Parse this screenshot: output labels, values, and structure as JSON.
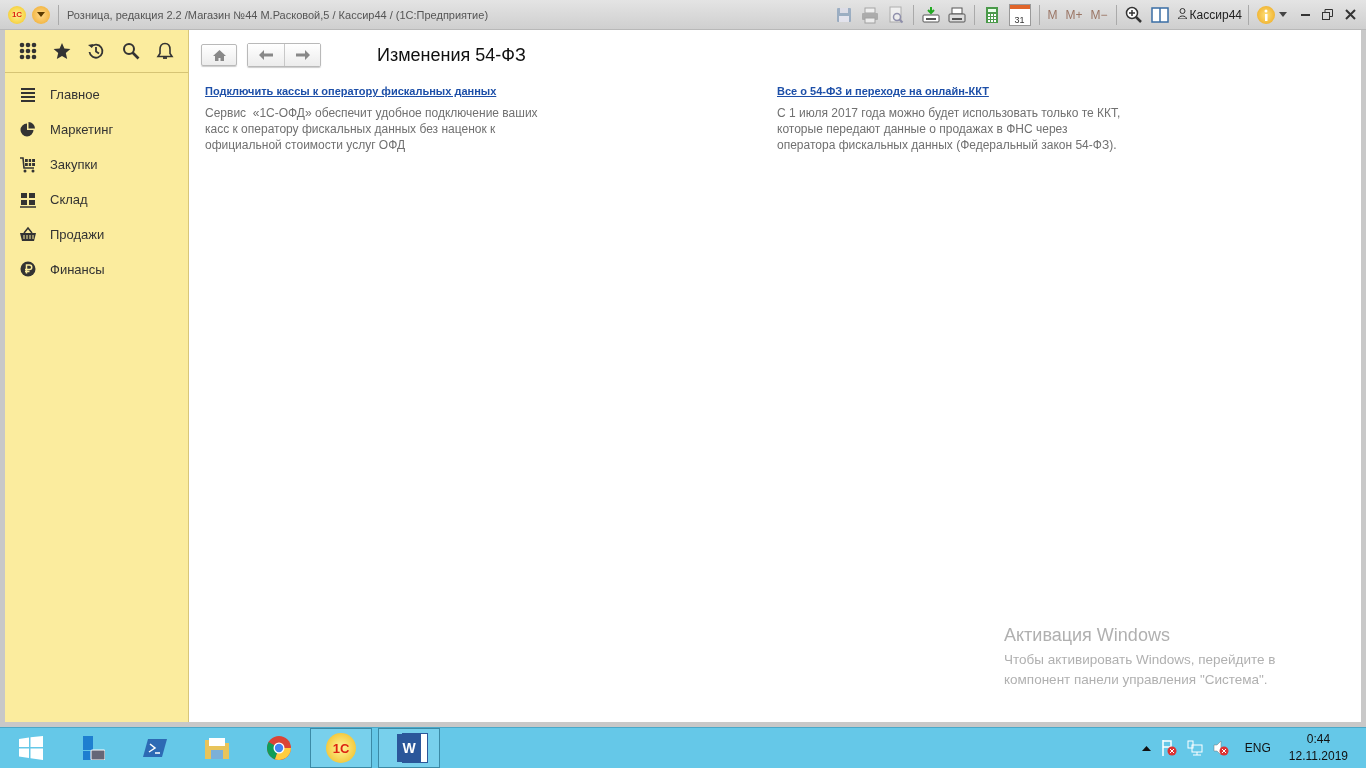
{
  "titlebar": {
    "logo": "1С",
    "title": "Розница, редакция 2.2 /Магазин №44 М.Расковой,5 / Кассир44 /  (1С:Предприятие)",
    "toolbar": [
      {
        "kind": "icon",
        "disabled": true
      },
      {
        "kind": "icon",
        "disabled": true
      },
      {
        "kind": "icon",
        "disabled": true
      },
      {
        "kind": "icon",
        "disabled": false
      },
      {
        "kind": "icon",
        "disabled": false
      },
      {
        "kind": "icon",
        "disabled": false
      },
      {
        "kind": "calendar",
        "label": "31",
        "disabled": false
      },
      {
        "kind": "text",
        "label": "M",
        "disabled": true
      },
      {
        "kind": "text",
        "label": "M+",
        "disabled": true
      },
      {
        "kind": "text",
        "label": "M−",
        "disabled": true
      },
      {
        "kind": "icon",
        "disabled": false
      },
      {
        "kind": "icon",
        "disabled": false
      }
    ],
    "user": "Кассир44"
  },
  "sidebar": {
    "items": [
      {
        "label": "Главное"
      },
      {
        "label": "Маркетинг"
      },
      {
        "label": "Закупки"
      },
      {
        "label": "Склад"
      },
      {
        "label": "Продажи"
      },
      {
        "label": "Финансы"
      }
    ]
  },
  "content": {
    "title": "Изменения 54-ФЗ",
    "news": [
      {
        "link": "Подключить кассы к оператору фискальных данных",
        "text": "Сервис  «1С-ОФД» обеспечит удобное подключение ваших касс к оператору фискальных данных без наценок к официальной стоимости услуг ОФД"
      },
      {
        "link": "Все о 54-ФЗ и переходе на онлайн-ККТ",
        "text": "С 1 июля 2017 года можно будет использовать только те ККТ, которые передают данные о продажах в ФНС через оператора фискальных данных (Федеральный закон 54-ФЗ)."
      }
    ]
  },
  "activation_notice": {
    "title": "Активация Windows",
    "text": "Чтобы активировать Windows, перейдите в компонент панели управления \"Система\"."
  },
  "taskbar": {
    "apps": [
      {
        "kind": "start",
        "open": false
      },
      {
        "kind": "server",
        "open": false
      },
      {
        "kind": "shell",
        "open": false
      },
      {
        "kind": "folder",
        "open": false
      },
      {
        "kind": "browser",
        "open": false
      },
      {
        "kind": "onec",
        "label": "1С",
        "open": true
      },
      {
        "kind": "word",
        "label": "W",
        "open": true
      }
    ],
    "language": "ENG",
    "time": "0:44",
    "date": "12.11.2019"
  }
}
